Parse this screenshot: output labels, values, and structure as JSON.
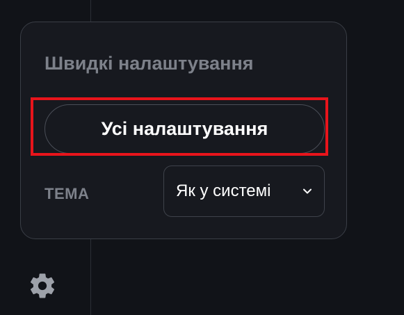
{
  "quick_settings": {
    "title": "Швидкі налаштування",
    "all_settings_label": "Усі налаштування",
    "theme_label": "ТЕМА",
    "theme_value": "Як у системі"
  },
  "icons": {
    "dropdown": "chevron-down-icon",
    "settings": "gear-icon"
  },
  "colors": {
    "background": "#111318",
    "panel": "#17191f",
    "muted_text": "#7d818a",
    "primary_text": "#ffffff",
    "highlight": "#e8141b"
  }
}
